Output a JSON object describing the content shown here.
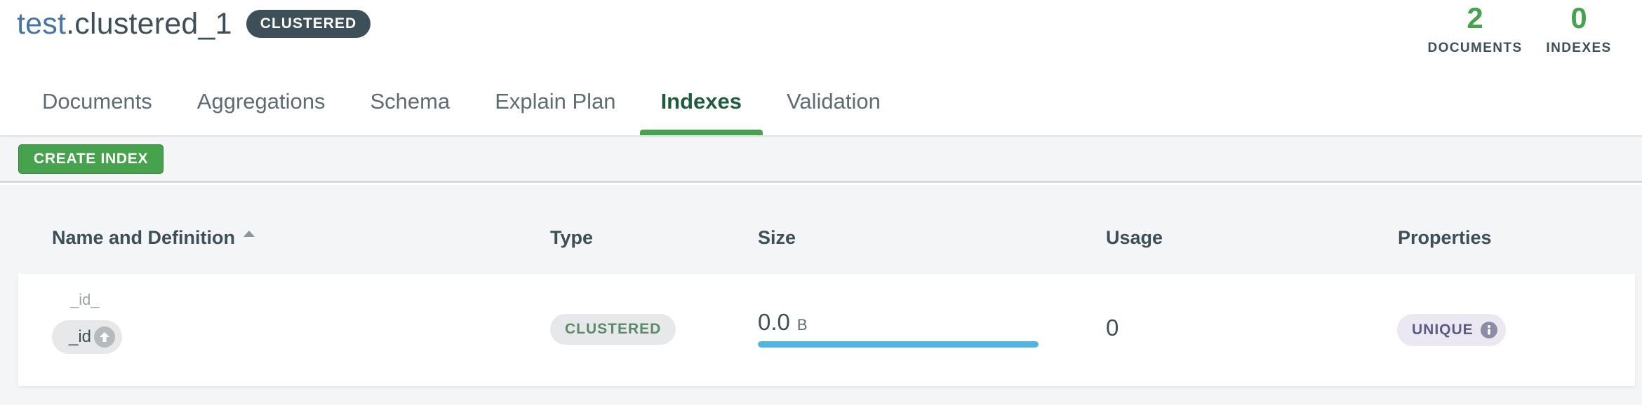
{
  "header": {
    "db_name": "test",
    "separator": ".",
    "collection_name": "clustered_1",
    "badge": "CLUSTERED"
  },
  "stats": {
    "documents": {
      "value": "2",
      "label": "DOCUMENTS"
    },
    "indexes": {
      "value": "0",
      "label": "INDEXES"
    }
  },
  "tabs": [
    {
      "label": "Documents",
      "active": false
    },
    {
      "label": "Aggregations",
      "active": false
    },
    {
      "label": "Schema",
      "active": false
    },
    {
      "label": "Explain Plan",
      "active": false
    },
    {
      "label": "Indexes",
      "active": true
    },
    {
      "label": "Validation",
      "active": false
    }
  ],
  "toolbar": {
    "create_index_label": "CREATE INDEX"
  },
  "table": {
    "columns": [
      "Name and Definition",
      "Type",
      "Size",
      "Usage",
      "Properties"
    ],
    "sort": {
      "column": "Name and Definition",
      "direction": "ascending"
    },
    "rows": [
      {
        "name": "_id_",
        "field": "_id",
        "field_direction_icon": "arrow-up-icon",
        "type": "CLUSTERED",
        "size_value": "0.0",
        "size_unit": "B",
        "size_fraction": 1.0,
        "usage": "0",
        "property": "UNIQUE",
        "property_icon": "info-icon"
      }
    ]
  },
  "colors": {
    "accent_green": "#47a24e",
    "active_tab_text": "#1f5b3d",
    "db_name_blue": "#4474a8",
    "size_bar_blue": "#50b5e0",
    "unique_pill_bg": "#ebe8f2"
  }
}
